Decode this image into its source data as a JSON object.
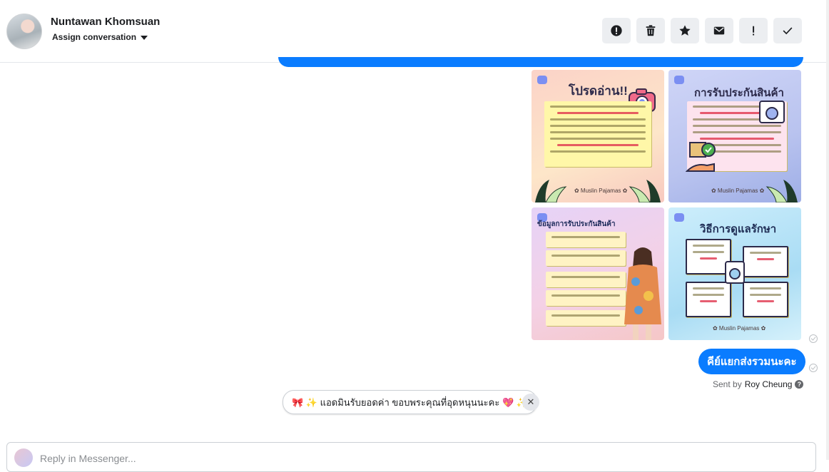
{
  "header": {
    "contact_name": "Nuntawan Khomsuan",
    "assign_label": "Assign conversation",
    "actions": [
      {
        "name": "report-icon"
      },
      {
        "name": "trash-icon"
      },
      {
        "name": "star-icon"
      },
      {
        "name": "envelope-icon"
      },
      {
        "name": "exclamation-icon"
      },
      {
        "name": "check-icon"
      }
    ]
  },
  "images": [
    {
      "title": "โปรดอ่าน!!",
      "brand": "✿ Muslin Pajamas ✿"
    },
    {
      "title": "การรับประกันสินค้า",
      "brand": "✿ Muslin Pajamas ✿"
    },
    {
      "title": "ข้อมูลการรับประกันสินค้า",
      "brand": ""
    },
    {
      "title": "วิธีการดูแลรักษา",
      "brand": "✿ Muslin Pajamas ✿"
    }
  ],
  "message": {
    "text": "คีย์แยกส่งรวมนะคะ",
    "sent_by_prefix": "Sent by",
    "sent_by_name": "Roy Cheung"
  },
  "suggested_reply": {
    "text": "🎀 ✨ แอดมินรับยอดค่า ขอบพระคุณที่อุดหนุนนะคะ 💖 ✨"
  },
  "composer": {
    "placeholder": "Reply in Messenger..."
  },
  "colors": {
    "accent": "#0a7cff",
    "button_bg": "#eceef1"
  }
}
